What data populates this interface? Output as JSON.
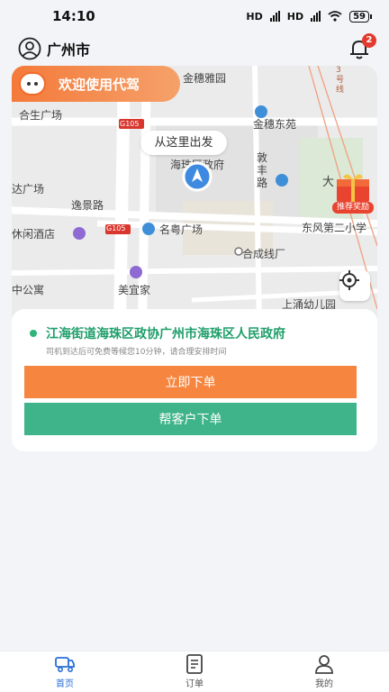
{
  "status_bar": {
    "time": "14:10",
    "network_label": "HD",
    "battery": "59"
  },
  "header": {
    "city": "广州市",
    "notification_count": "2"
  },
  "map": {
    "welcome_text": "欢迎使用代驾",
    "depart_tip": "从这里出发",
    "reward_label": "推荐奖励",
    "labels": {
      "jinsui_garden": "金穗雅园",
      "hesheng_plaza": "合生广场",
      "jinsui_east": "金穗东苑",
      "haizhu_gov": "海珠区政府",
      "dunfeng_road": "敦丰路",
      "da_plaza": "达广场",
      "yijing_road": "逸景路",
      "leisure_hotel": "休闲酒店",
      "mingyue_plaza": "名粤广场",
      "dongfeng_school": "东风第二小学",
      "hecheng_line": "合成线厂",
      "apartment": "中公寓",
      "meiyijia": "美宜家",
      "shangyong_kinder": "上涌幼儿园",
      "g105_a": "G105",
      "g105_b": "G105",
      "line3": "3号线",
      "da_partial": "大"
    }
  },
  "order": {
    "address": "江海街道海珠区政协广州市海珠区人民政府",
    "hint": "司机到达后可免费等候您10分钟，请合理安排时间",
    "order_now": "立即下单",
    "order_for_customer": "帮客户下单"
  },
  "tabs": [
    {
      "label": "首页",
      "icon": "car-icon"
    },
    {
      "label": "订单",
      "icon": "document-icon"
    },
    {
      "label": "我的",
      "icon": "user-icon"
    }
  ],
  "colors": {
    "accent_orange": "#f5853f",
    "accent_green": "#3fb48a",
    "active_tab": "#2a6fd6"
  }
}
